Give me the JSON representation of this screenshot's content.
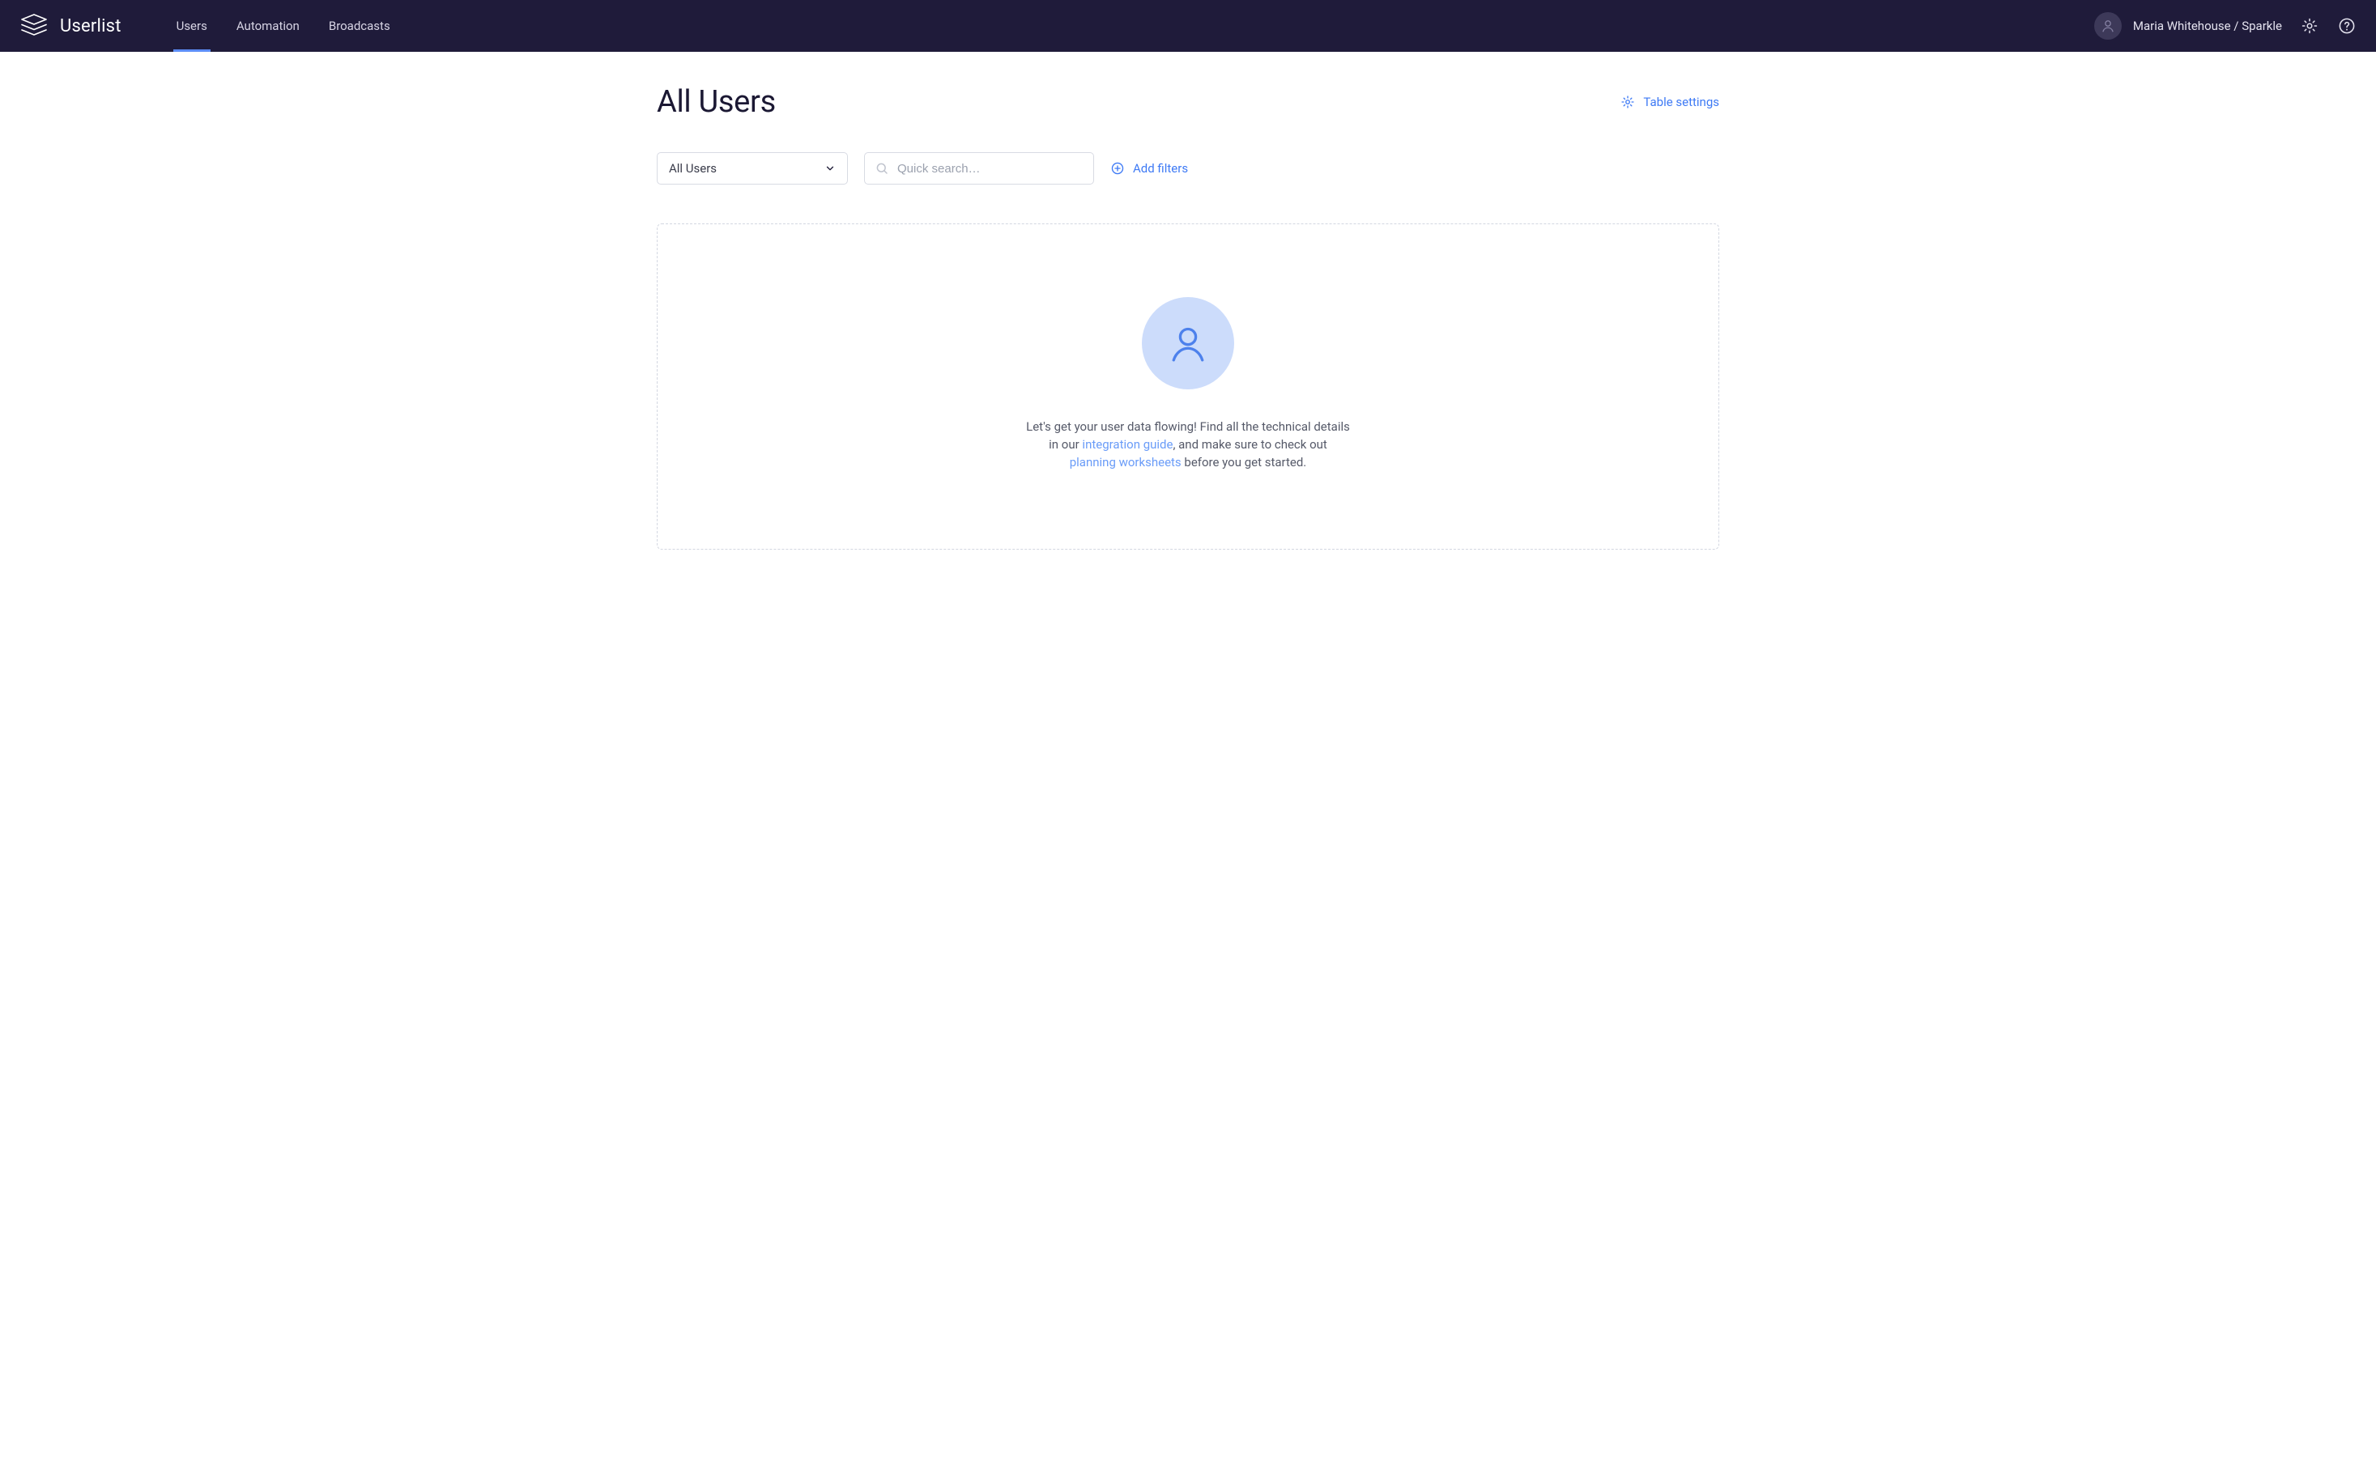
{
  "brand": {
    "name": "Userlist"
  },
  "nav": {
    "items": [
      {
        "label": "Users",
        "active": true
      },
      {
        "label": "Automation",
        "active": false
      },
      {
        "label": "Broadcasts",
        "active": false
      }
    ]
  },
  "user": {
    "display": "Maria Whitehouse / Sparkle"
  },
  "page": {
    "title": "All Users",
    "table_settings_label": "Table settings"
  },
  "filters": {
    "segment_select": {
      "value": "All Users"
    },
    "search": {
      "placeholder": "Quick search…"
    },
    "add_filters_label": "Add filters"
  },
  "empty_state": {
    "text_1": "Let's get your user data flowing! Find all the technical details in our ",
    "link_1": "integration guide",
    "text_2": ", and make sure to check out ",
    "link_2": "planning worksheets",
    "text_3": " before you get started."
  }
}
